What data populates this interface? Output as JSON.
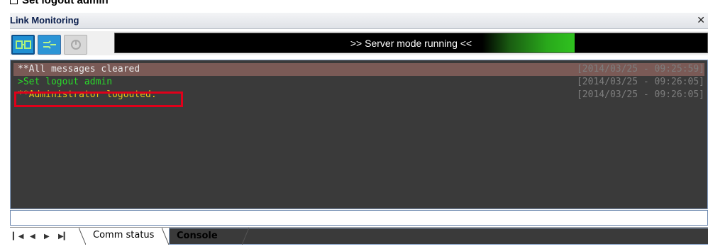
{
  "caption": {
    "text": "Set logout admin",
    "icon": "checkbox-icon"
  },
  "window": {
    "title": "Link Monitoring",
    "close_label": "✕"
  },
  "toolbar": {
    "buttons": [
      {
        "name": "connect-active-icon",
        "color": "#1f8fd2"
      },
      {
        "name": "connect-icon",
        "color": "#2c95d6"
      },
      {
        "name": "disabled-link-icon",
        "color": "#d8d8d8"
      }
    ],
    "status_text": ">> Server mode running <<",
    "status_colors": {
      "background": "#000000",
      "progress": "#2fc21f",
      "text": "#ffffff"
    }
  },
  "console": {
    "rows": [
      {
        "message": "**All messages cleared",
        "timestamp": "[2014/03/25 - 09:25:59]",
        "color": "#e8e8e8",
        "selected": true
      },
      {
        "message": ">Set logout admin",
        "timestamp": "[2014/03/25 - 09:26:05]",
        "color": "#2ad82a"
      },
      {
        "message": "**Administrator logouted.",
        "timestamp": "[2014/03/25 - 09:26:05]",
        "color": "#e8c619"
      }
    ],
    "highlight_color": "#e0001a"
  },
  "input": {
    "value": "",
    "placeholder": ""
  },
  "tabs": {
    "nav": [
      "first-icon",
      "prev-icon",
      "next-icon",
      "last-icon"
    ],
    "items": [
      {
        "label": "Comm status",
        "active": false
      },
      {
        "label": "Console",
        "active": true
      }
    ]
  }
}
